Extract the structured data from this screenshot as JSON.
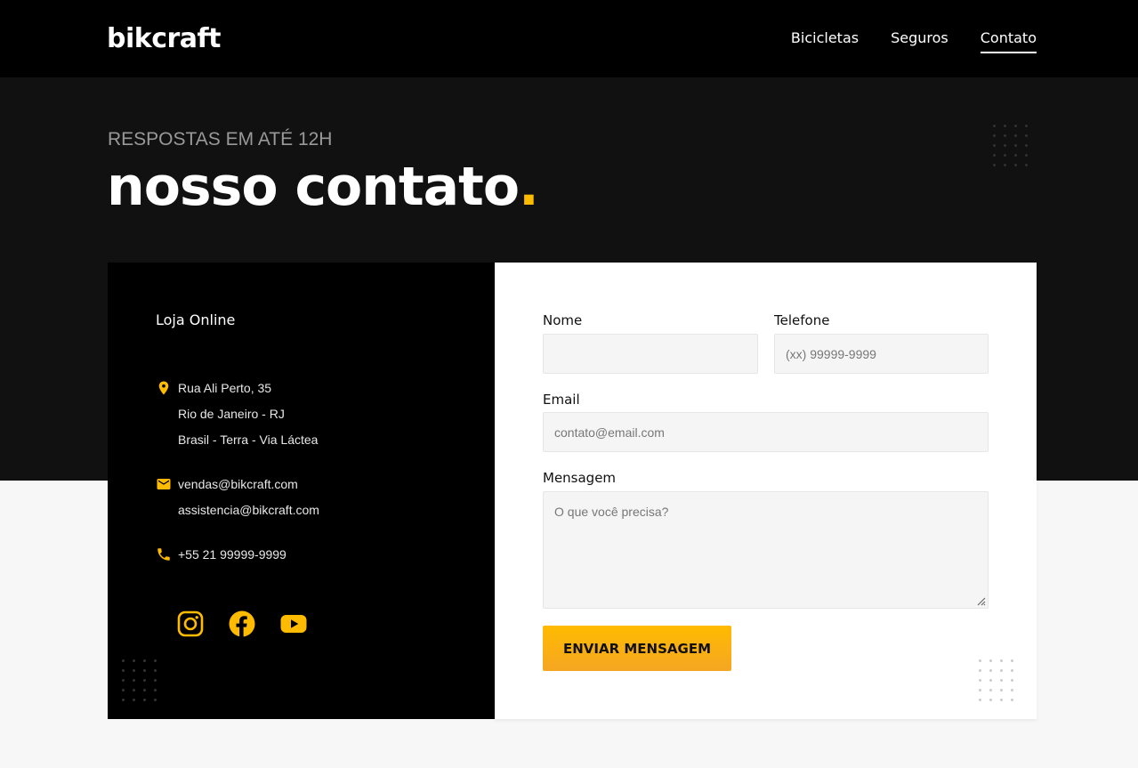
{
  "header": {
    "logo": "bikcraft",
    "nav": [
      "Bicicletas",
      "Seguros",
      "Contato"
    ],
    "active_nav": "Contato"
  },
  "hero": {
    "subtitle": "RESPOSTAS EM ATÉ 12H",
    "title": "nosso contato",
    "title_dot": "."
  },
  "info": {
    "title": "Loja Online",
    "address": [
      "Rua Ali Perto, 35",
      "Rio de Janeiro - RJ",
      "Brasil - Terra - Via Láctea"
    ],
    "emails": [
      "vendas@bikcraft.com",
      "assistencia@bikcraft.com"
    ],
    "phone": "+55 21 99999-9999",
    "social_icons": [
      "instagram-icon",
      "facebook-icon",
      "youtube-icon"
    ]
  },
  "form": {
    "name_label": "Nome",
    "name_value": "",
    "phone_label": "Telefone",
    "phone_placeholder": "(xx) 99999-9999",
    "email_label": "Email",
    "email_placeholder": "contato@email.com",
    "message_label": "Mensagem",
    "message_placeholder": "O que você precisa?",
    "submit_label": "ENVIAR MENSAGEM"
  },
  "colors": {
    "accent": "#ffbb00",
    "header_bg": "#000000",
    "hero_bg": "#111111",
    "page_bg": "#f7f7f7"
  }
}
